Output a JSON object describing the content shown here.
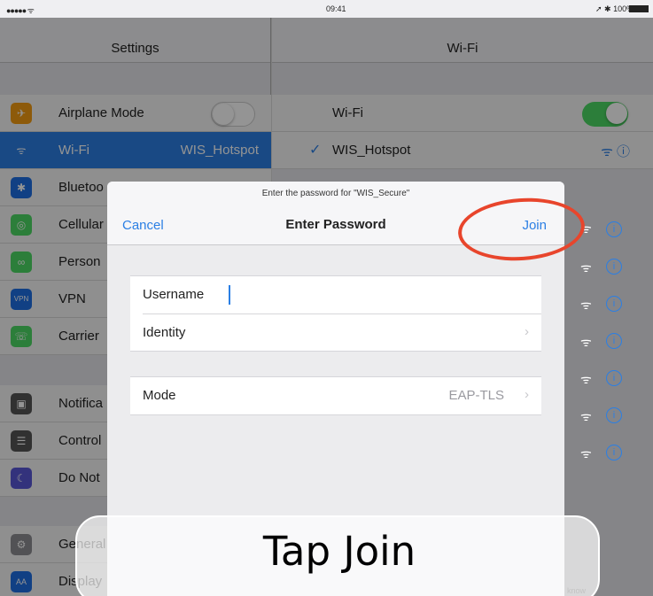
{
  "status_bar": {
    "signal": "●●●●● ᯤ",
    "time": "09:41",
    "battery": "➚ ✱ 100%"
  },
  "sidebar": {
    "title": "Settings",
    "items": [
      {
        "label": "Airplane Mode",
        "value": "",
        "icon": "airplane-icon",
        "color": "#f39c12",
        "glyph": "✈",
        "toggle": true
      },
      {
        "label": "Wi-Fi",
        "value": "WIS_Hotspot",
        "icon": "wifi-icon",
        "color": "#2b7fe4",
        "glyph": "ᯤ",
        "selected": true
      },
      {
        "label": "Bluetoo",
        "value": "",
        "icon": "bluetooth-icon",
        "color": "#1e6fe4",
        "glyph": "✱"
      },
      {
        "label": "Cellular",
        "value": "",
        "icon": "cellular-icon",
        "color": "#4cd964",
        "glyph": "◎"
      },
      {
        "label": "Person",
        "value": "",
        "icon": "hotspot-icon",
        "color": "#4cd964",
        "glyph": "∞"
      },
      {
        "label": "VPN",
        "value": "",
        "icon": "vpn-icon",
        "color": "#1e6fe4",
        "glyph": "VPN"
      },
      {
        "label": "Carrier",
        "value": "",
        "icon": "phone-icon",
        "color": "#4cd964",
        "glyph": "☏"
      },
      {
        "label": "Notifica",
        "value": "",
        "icon": "notifications-icon",
        "color": "#555",
        "glyph": "▣"
      },
      {
        "label": "Control",
        "value": "",
        "icon": "control-center-icon",
        "color": "#555",
        "glyph": "☰"
      },
      {
        "label": "Do Not",
        "value": "",
        "icon": "moon-icon",
        "color": "#5856d6",
        "glyph": "☾"
      },
      {
        "label": "General",
        "value": "",
        "icon": "gear-icon",
        "color": "#8e8e93",
        "glyph": "⚙"
      },
      {
        "label": "Display",
        "value": "",
        "icon": "display-icon",
        "color": "#1e6fe4",
        "glyph": "AA"
      }
    ]
  },
  "detail": {
    "title": "Wi-Fi",
    "wifi_label": "Wi-Fi",
    "connected_network": "WIS_Hotspot",
    "know_text": "know"
  },
  "modal": {
    "prompt": "Enter the password for \"WIS_Secure\"",
    "cancel_label": "Cancel",
    "title": "Enter Password",
    "join_label": "Join",
    "username_label": "Username",
    "identity_label": "Identity",
    "mode_label": "Mode",
    "mode_value": "EAP-TLS"
  },
  "callout": {
    "text": "Tap Join",
    "circle_color": "#e8452c"
  },
  "colors": {
    "accent": "#2b7fe4",
    "toggle_on": "#4cd964"
  }
}
